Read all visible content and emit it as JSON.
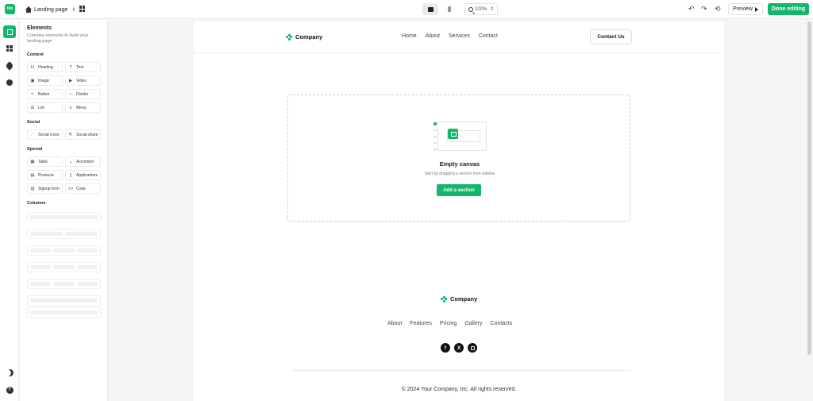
{
  "topbar": {
    "logo_text": "lite",
    "page_name": "Landing page",
    "zoom_level": "100%",
    "preview_label": "Preview",
    "done_label": "Done editing"
  },
  "sidebar": {
    "title": "Elements",
    "subtitle": "Combine elements to build your landing page",
    "sections": {
      "content": "Content",
      "social": "Social",
      "special": "Special",
      "columns": "Columns"
    },
    "content_items": [
      {
        "label": "Heading",
        "icon": "H"
      },
      {
        "label": "Text",
        "icon": "T"
      },
      {
        "label": "Image",
        "icon": "▣"
      },
      {
        "label": "Video",
        "icon": "▶"
      },
      {
        "label": "Button",
        "icon": "↖"
      },
      {
        "label": "Divider",
        "icon": "—"
      },
      {
        "label": "List",
        "icon": "☰"
      },
      {
        "label": "Menu",
        "icon": "≡"
      }
    ],
    "social_items": [
      {
        "label": "Social icons",
        "icon": "⋰"
      },
      {
        "label": "Social share",
        "icon": "⇱"
      }
    ],
    "special_items": [
      {
        "label": "Table",
        "icon": "▦"
      },
      {
        "label": "Accordion",
        "icon": "⌄"
      },
      {
        "label": "Products",
        "icon": "▤"
      },
      {
        "label": "Applications",
        "icon": "▯"
      },
      {
        "label": "Signup form",
        "icon": "▥"
      },
      {
        "label": "Code",
        "icon": "<>"
      }
    ]
  },
  "canvas": {
    "brand": "Company",
    "nav_links": [
      "Home",
      "About",
      "Services",
      "Contact"
    ],
    "contact_button": "Contact Us",
    "empty_title": "Empty canvas",
    "empty_subtitle": "Start by dragging a section from sidebar",
    "add_section_button": "Add a section",
    "footer_brand": "Company",
    "footer_links": [
      "About",
      "Features",
      "Pricing",
      "Gallery",
      "Contacts"
    ],
    "social_icons": [
      "facebook-icon",
      "x-icon",
      "instagram-icon"
    ],
    "copyright": "© 2024 Your Company, Inc. All rights reserved."
  },
  "colors": {
    "accent": "#12b76a"
  }
}
